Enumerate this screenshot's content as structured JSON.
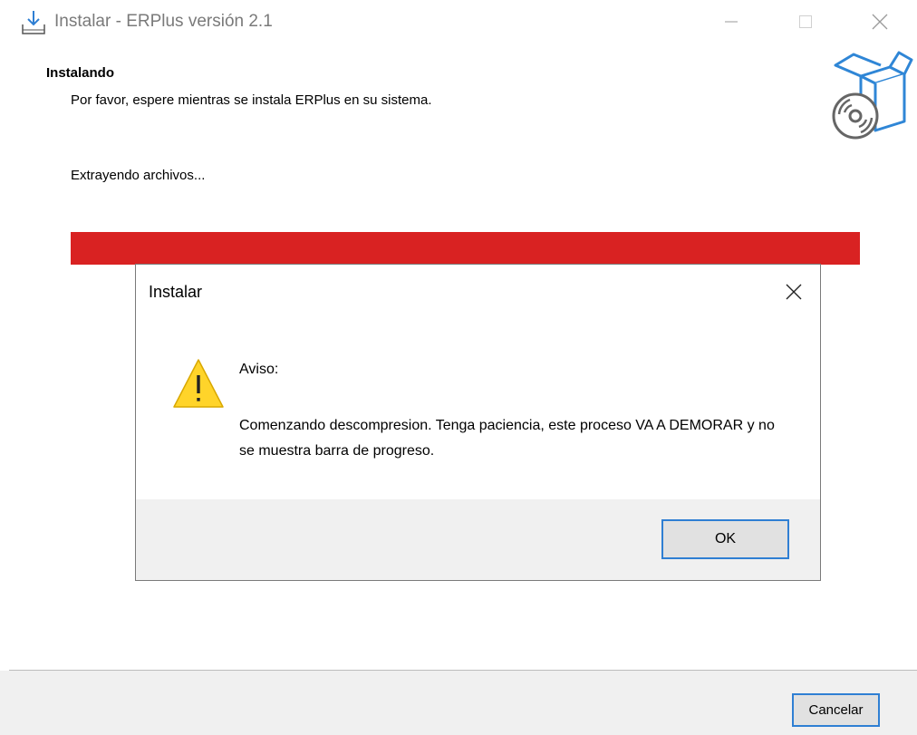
{
  "window": {
    "title": "Instalar - ERPlus versión 2.1",
    "icon": "install-download-icon",
    "controls": {
      "minimize": "minimize-icon",
      "maximize": "maximize-icon",
      "close": "close-icon"
    }
  },
  "header": {
    "title": "Instalando",
    "subtitle": "Por favor, espere mientras se instala ERPlus en su sistema.",
    "icon": "software-box-disc-icon"
  },
  "status": {
    "text": "Extrayendo archivos...",
    "progress_fraction": 1.0,
    "progress_color": "#d92222"
  },
  "dialog": {
    "title": "Instalar",
    "icon": "warning-icon",
    "heading": "Aviso:",
    "message": "Comenzando descompresion. Tenga paciencia, este proceso VA A DEMORAR y no se muestra barra de progreso.",
    "ok_label": "OK",
    "accent": "#2f7fd3"
  },
  "footer": {
    "cancel_label": "Cancelar"
  }
}
